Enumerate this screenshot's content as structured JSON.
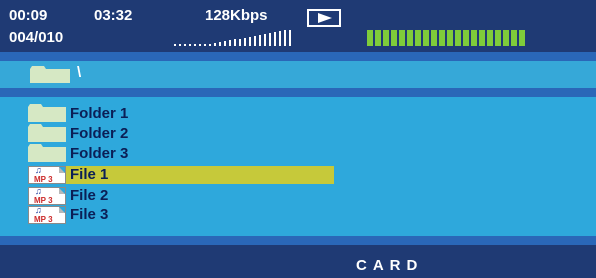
{
  "status": {
    "elapsed": "00:09",
    "total_time": "03:32",
    "bitrate": "128Kbps",
    "track_index": "004/010",
    "playback_state_icon": "play-icon",
    "accent_color": "#7fcc3a"
  },
  "path": {
    "current": "\\",
    "icon": "folder-icon"
  },
  "files": [
    {
      "name": "Folder 1",
      "type": "folder",
      "icon": "folder-icon",
      "selected": false
    },
    {
      "name": "Folder 2",
      "type": "folder",
      "icon": "folder-icon",
      "selected": false
    },
    {
      "name": "Folder 3",
      "type": "folder",
      "icon": "folder-icon",
      "selected": false
    },
    {
      "name": "File 1",
      "type": "mp3",
      "icon": "mp3-file-icon",
      "selected": true
    },
    {
      "name": "File 2",
      "type": "mp3",
      "icon": "mp3-file-icon",
      "selected": false
    },
    {
      "name": "File 3",
      "type": "mp3",
      "icon": "mp3-file-icon",
      "selected": false
    }
  ],
  "mp3_icon_text": "MP 3",
  "source": {
    "device": "CARD"
  },
  "colors": {
    "background": "#1f3a74",
    "list_bg": "#2ea8dc",
    "highlight": "#c6c93a",
    "text_dark": "#0b1f56"
  }
}
